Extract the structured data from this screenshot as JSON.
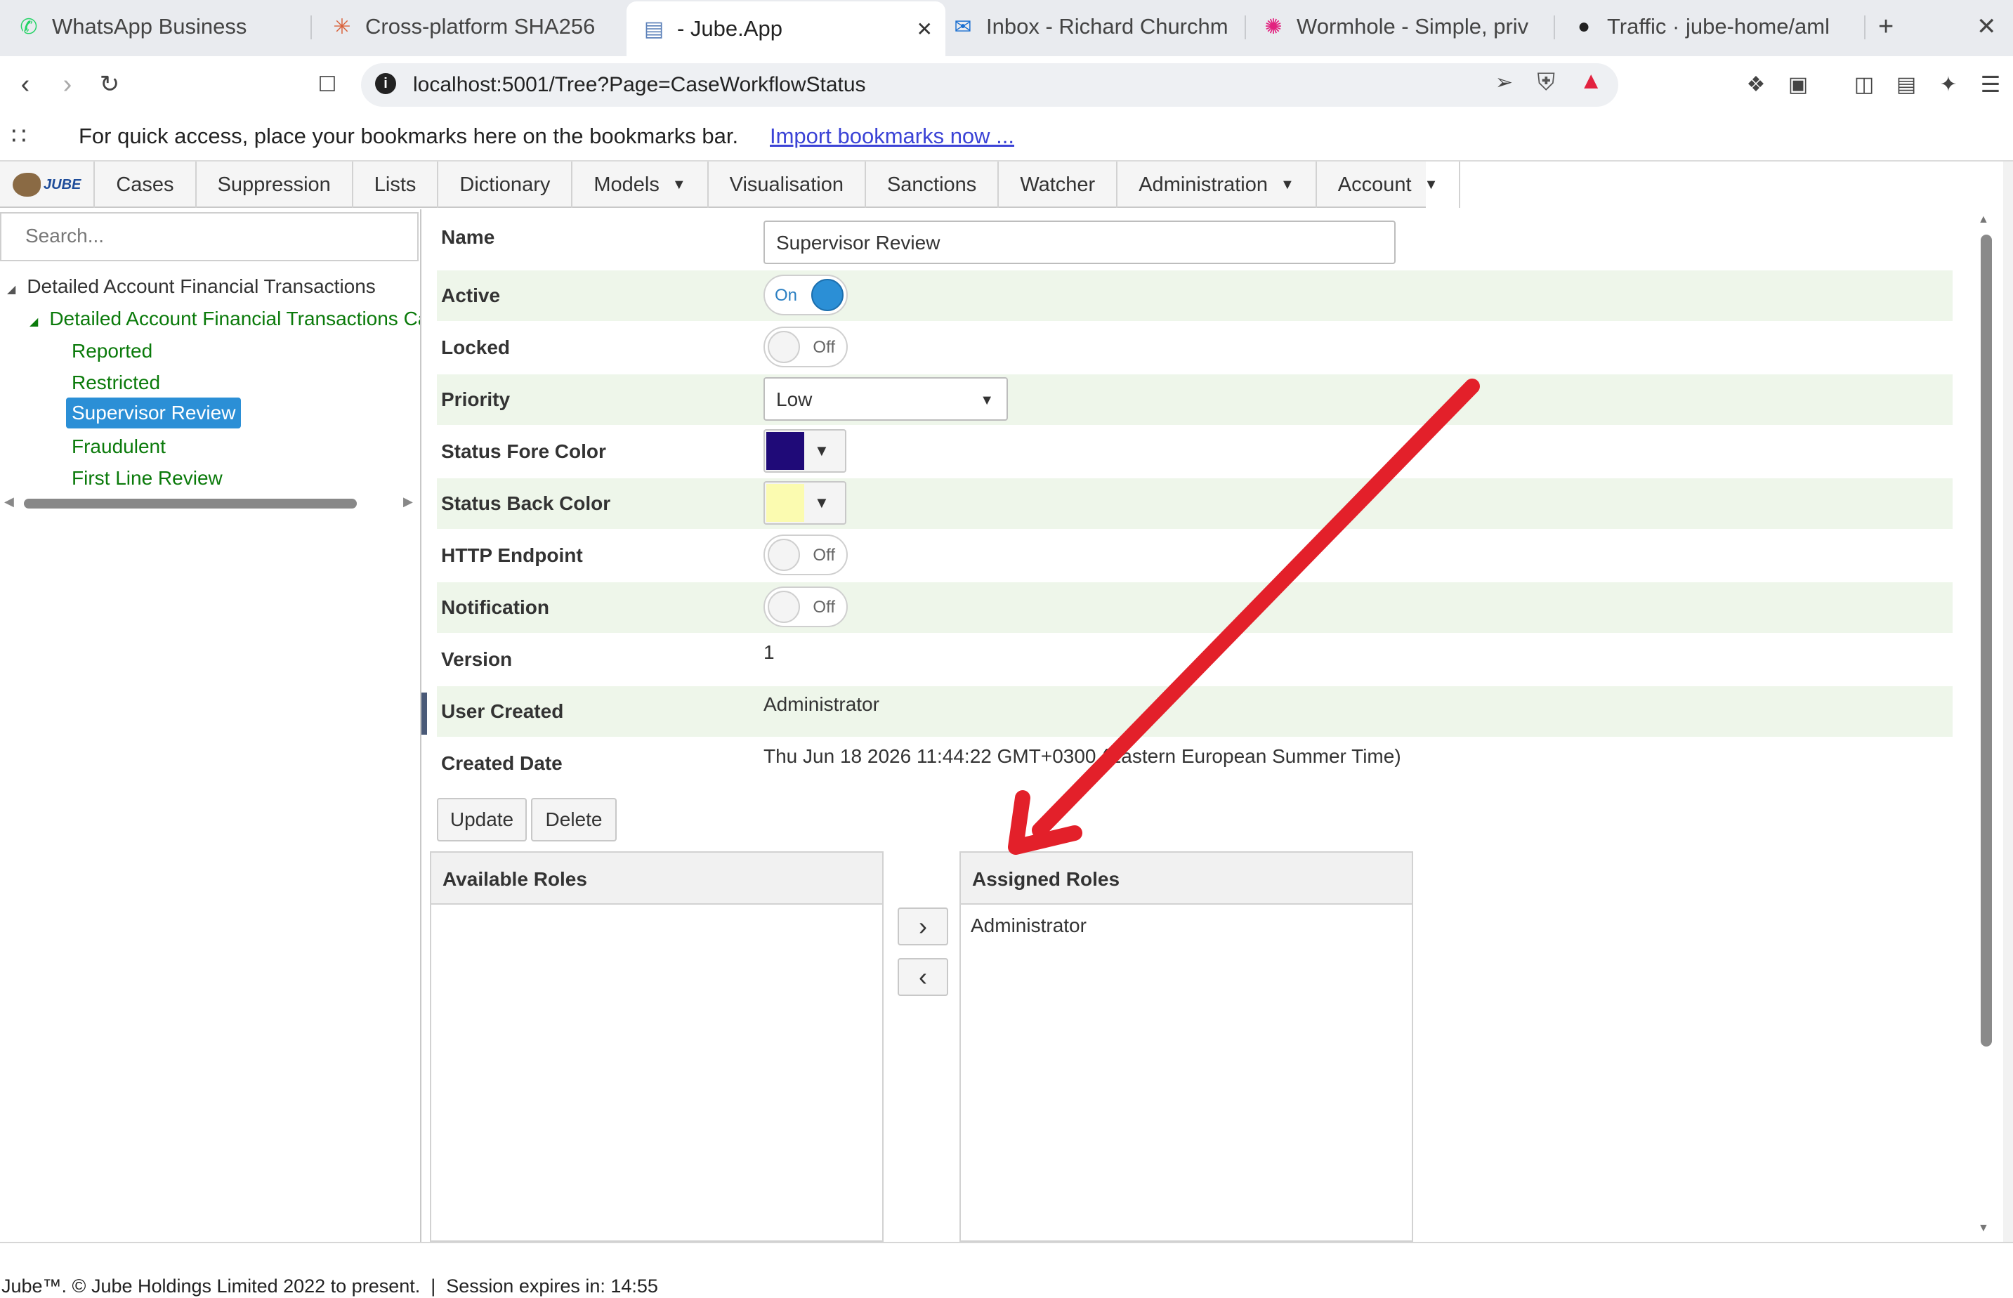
{
  "browser": {
    "tabs": [
      {
        "title": "WhatsApp Business",
        "icon": "whatsapp-icon"
      },
      {
        "title": "Cross-platform SHA256",
        "icon": "sparkle-icon"
      },
      {
        "title": "- Jube.App",
        "icon": "document-icon"
      },
      {
        "title": "Inbox - Richard Churchm",
        "icon": "outlook-icon"
      },
      {
        "title": "Wormhole - Simple, priv",
        "icon": "wormhole-icon"
      },
      {
        "title": "Traffic · jube-home/aml",
        "icon": "github-icon"
      }
    ],
    "new_tab": "+",
    "close_tab": "✕",
    "url": "localhost:5001/Tree?Page=CaseWorkflowStatus",
    "bookmarks_prompt": "For quick access, place your bookmarks here on the bookmarks bar.",
    "import_link": "Import bookmarks now ..."
  },
  "app": {
    "logo_text": "JUBE",
    "menu": [
      {
        "label": "Cases",
        "dropdown": false
      },
      {
        "label": "Suppression",
        "dropdown": false
      },
      {
        "label": "Lists",
        "dropdown": false
      },
      {
        "label": "Dictionary",
        "dropdown": false
      },
      {
        "label": "Models",
        "dropdown": true
      },
      {
        "label": "Visualisation",
        "dropdown": false
      },
      {
        "label": "Sanctions",
        "dropdown": false
      },
      {
        "label": "Watcher",
        "dropdown": false
      },
      {
        "label": "Administration",
        "dropdown": true
      },
      {
        "label": "Account",
        "dropdown": true
      }
    ],
    "search_placeholder": "Search...",
    "tree": {
      "root": "Detailed Account Financial Transactions",
      "child": "Detailed Account Financial Transactions Ca",
      "leaves": [
        "Reported",
        "Restricted",
        "Supervisor Review",
        "Fraudulent",
        "First Line Review"
      ],
      "selected": "Supervisor Review"
    },
    "form": {
      "name_label": "Name",
      "name_value": "Supervisor Review",
      "active_label": "Active",
      "active_state": "On",
      "locked_label": "Locked",
      "locked_state": "Off",
      "priority_label": "Priority",
      "priority_value": "Low",
      "fore_label": "Status Fore Color",
      "fore_color": "#1f0a78",
      "back_label": "Status Back Color",
      "back_color": "#fbfbb0",
      "http_label": "HTTP Endpoint",
      "http_state": "Off",
      "notif_label": "Notification",
      "notif_state": "Off",
      "version_label": "Version",
      "version_value": "1",
      "user_label": "User Created",
      "user_value": "Administrator",
      "date_label": "Created Date",
      "date_value": "Thu Jun 18 2026 11:44:22 GMT+0300 (Eastern European Summer Time)"
    },
    "update_button": "Update",
    "delete_button": "Delete",
    "available_roles_title": "Available Roles",
    "available_roles": [],
    "assigned_roles_title": "Assigned Roles",
    "assigned_roles": [
      "Administrator"
    ],
    "move_right": "›",
    "move_left": "‹",
    "footer": "Jube™. © Jube Holdings Limited 2022 to present.  |  Session expires in: 14:55",
    "accent_color": "#2b8fd6",
    "tree_text_color": "#0a7a0a",
    "arrow_color": "#e3202a"
  }
}
